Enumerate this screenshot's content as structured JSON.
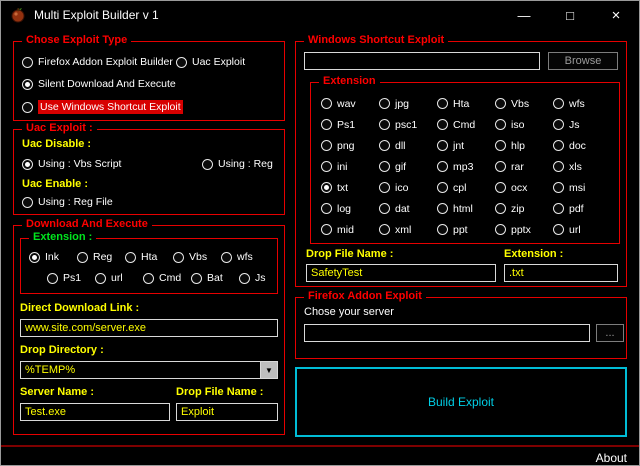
{
  "window": {
    "title": "Multi Exploit Builder v 1",
    "minimize_glyph": "—",
    "maximize_glyph": "□",
    "close_glyph": "×"
  },
  "exploit_type": {
    "title": "Chose Exploit Type",
    "options": [
      {
        "label": "Firefox Addon Exploit Builder",
        "selected": false
      },
      {
        "label": "Uac Exploit",
        "selected": false
      },
      {
        "label": "Silent Download And Execute",
        "selected": true
      },
      {
        "label": "Use Windows Shortcut Exploit",
        "selected": false,
        "highlighted": true
      }
    ]
  },
  "uac": {
    "title": "Uac Exploit :",
    "disable_label": "Uac Disable :",
    "enable_label": "Uac Enable :",
    "options": [
      {
        "label": "Using : Vbs Script",
        "selected": true
      },
      {
        "label": "Using : Reg",
        "selected": false
      },
      {
        "label": "Using : Reg File",
        "selected": false
      }
    ]
  },
  "download_execute": {
    "title": "Download And Execute",
    "extension_title": "Extension :",
    "extensions_row1": [
      {
        "label": "Ink",
        "selected": true
      },
      {
        "label": "Reg"
      },
      {
        "label": "Hta"
      },
      {
        "label": "Vbs"
      },
      {
        "label": "wfs"
      }
    ],
    "extensions_row2": [
      {
        "label": "Ps1"
      },
      {
        "label": "url"
      },
      {
        "label": "Cmd"
      },
      {
        "label": "Bat"
      },
      {
        "label": "Js"
      }
    ],
    "direct_link_label": "Direct Download Link :",
    "direct_link_value": "www.site.com/server.exe",
    "drop_directory_label": "Drop Directory :",
    "drop_directory_value": "%TEMP%",
    "server_name_label": "Server Name :",
    "server_name_value": "Test.exe",
    "drop_file_label": "Drop File Name :",
    "drop_file_value": "Exploit"
  },
  "shortcut_exploit": {
    "title": "Windows Shortcut Exploit",
    "file_value": "",
    "browse_label": "Browse",
    "extension_title": "Extension",
    "extensions": [
      {
        "label": "wav"
      },
      {
        "label": "jpg"
      },
      {
        "label": "Hta"
      },
      {
        "label": "Vbs"
      },
      {
        "label": "wfs"
      },
      {
        "label": "Ps1"
      },
      {
        "label": "psc1"
      },
      {
        "label": "Cmd"
      },
      {
        "label": "iso"
      },
      {
        "label": "Js"
      },
      {
        "label": "png"
      },
      {
        "label": "dll"
      },
      {
        "label": "jnt"
      },
      {
        "label": "hlp"
      },
      {
        "label": "doc"
      },
      {
        "label": "ini"
      },
      {
        "label": "gif"
      },
      {
        "label": "mp3"
      },
      {
        "label": "rar"
      },
      {
        "label": "xls"
      },
      {
        "label": "txt",
        "selected": true
      },
      {
        "label": "ico"
      },
      {
        "label": "cpl"
      },
      {
        "label": "ocx"
      },
      {
        "label": "msi"
      },
      {
        "label": "log"
      },
      {
        "label": "dat"
      },
      {
        "label": "html"
      },
      {
        "label": "zip"
      },
      {
        "label": "pdf"
      },
      {
        "label": "mid"
      },
      {
        "label": "xml"
      },
      {
        "label": "ppt"
      },
      {
        "label": "pptx"
      },
      {
        "label": "url"
      }
    ],
    "drop_file_label": "Drop File Name :",
    "drop_file_value": "SafetyTest",
    "extension_label": "Extension :",
    "extension_value": ".txt"
  },
  "firefox_addon": {
    "title": "Firefox Addon Exploit",
    "server_label": "Chose your server",
    "server_value": "",
    "browse_label": "..."
  },
  "build_button": "Build Exploit",
  "about_label": "About",
  "colors": {
    "accent_red": "#ff0000",
    "label_yellow": "#ffff00",
    "extension_green": "#00e51e",
    "build_cyan": "#00cfe6",
    "highlight_red": "#d70000",
    "separator_maroon": "#7e0000"
  }
}
